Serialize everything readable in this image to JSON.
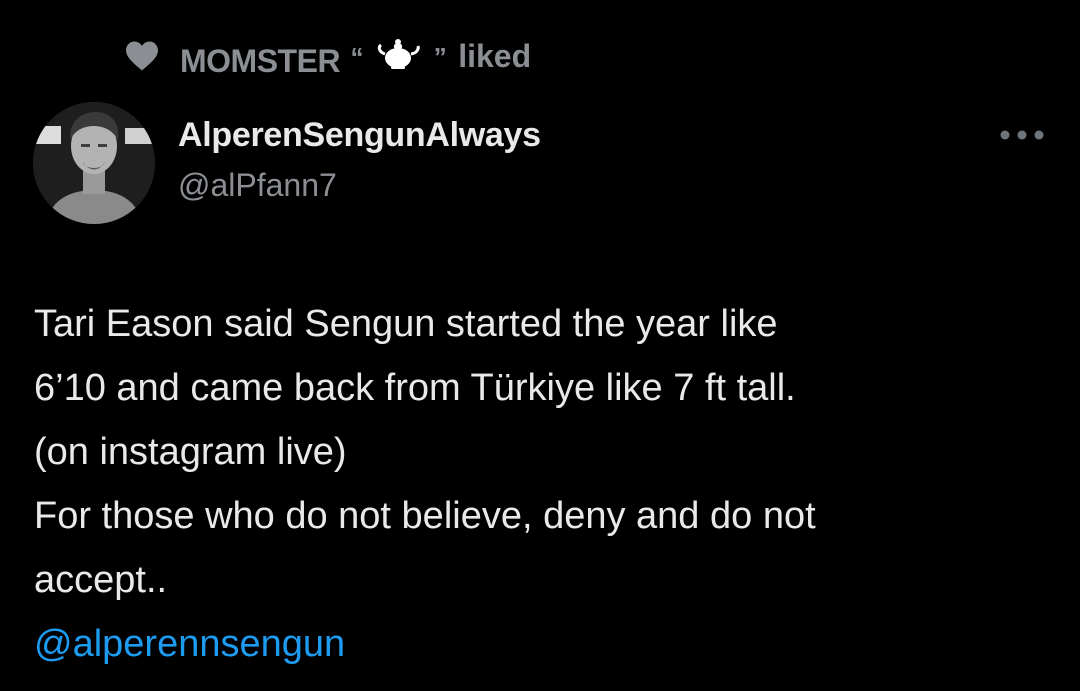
{
  "social_context": {
    "liker_name": "MOMSTER",
    "open_quote": "“",
    "close_quote": "”",
    "emoji_icon": "teapot-icon",
    "action_text": "liked",
    "heart_icon": "heart-icon"
  },
  "tweet": {
    "author": {
      "display_name": "AlperenSengunAlways",
      "handle": "@alPfann7",
      "avatar": "avatar"
    },
    "more_icon": "more-horizontal-icon",
    "text_lines": [
      "Tari Eason said Sengun started the year like",
      "6’10 and came back from Türkiye like 7 ft tall.",
      "(on instagram live)",
      "For those who do not believe, deny and do not",
      "accept.."
    ],
    "mention": "@alperennsengun"
  },
  "colors": {
    "background": "#000000",
    "primary_text": "#e7e9ea",
    "secondary_text": "#8b8f94",
    "link": "#1d9bf0"
  }
}
